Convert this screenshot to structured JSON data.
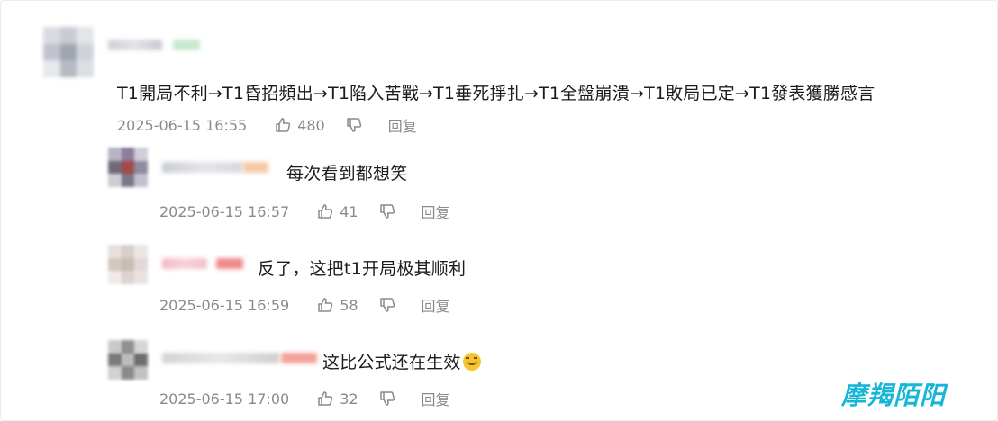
{
  "main_comment": {
    "text": "T1開局不利→T1昏招頻出→T1陷入苦戰→T1垂死掙扎→T1全盤崩潰→T1敗局已定→T1發表獲勝感言",
    "time": "2025-06-15 16:55",
    "likes": "480",
    "reply_label": "回复"
  },
  "replies": [
    {
      "text": "每次看到都想笑",
      "time": "2025-06-15 16:57",
      "likes": "41",
      "reply_label": "回复"
    },
    {
      "text": "反了，这把t1开局极其顺利",
      "time": "2025-06-15 16:59",
      "likes": "58",
      "reply_label": "回复"
    },
    {
      "text": "这比公式还在生效",
      "time": "2025-06-15 17:00",
      "likes": "32",
      "reply_label": "回复"
    }
  ],
  "watermark": "摩羯陌阳",
  "icons": [
    "thumb-up-icon",
    "thumb-down-icon",
    "laughing-emoji-icon"
  ],
  "colors": {
    "meta_text": "#8a8a8a",
    "watermark": "#16b6d6"
  }
}
